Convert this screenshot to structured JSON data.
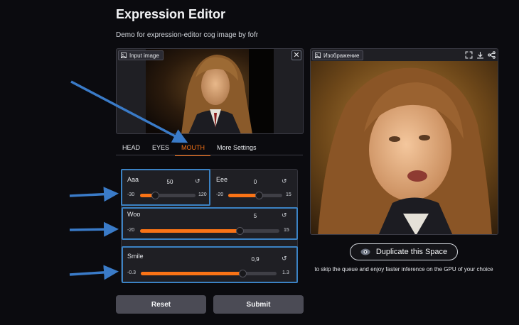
{
  "page": {
    "title": "Expression Editor",
    "subtitle": "Demo for expression-editor cog image by fofr"
  },
  "input_panel": {
    "label": "Input image",
    "close": "✕"
  },
  "output_panel": {
    "label": "Изображение"
  },
  "tabs": [
    "HEAD",
    "EYES",
    "MOUTH",
    "More Settings"
  ],
  "active_tab": "MOUTH",
  "sliders": {
    "aaa": {
      "label": "Aaa",
      "value": "50",
      "min": "-30",
      "max": "120",
      "fraction": 0.267
    },
    "eee": {
      "label": "Eee",
      "value": "0",
      "min": "-20",
      "max": "15",
      "fraction": 0.571
    },
    "woo": {
      "label": "Woo",
      "value": "5",
      "min": "-20",
      "max": "15",
      "fraction": 0.714
    },
    "smile": {
      "label": "Smile",
      "value": "0,9",
      "min": "-0.3",
      "max": "1.3",
      "fraction": 0.75
    }
  },
  "reset_glyph": "↺",
  "buttons": {
    "reset": "Reset",
    "submit": "Submit"
  },
  "duplicate": {
    "label": "Duplicate this Space",
    "description": "to skip the queue and enjoy faster inference on the GPU of your choice"
  },
  "colors": {
    "accent": "#f97316",
    "highlight": "#3b82c4",
    "background": "#0b0b0f"
  }
}
